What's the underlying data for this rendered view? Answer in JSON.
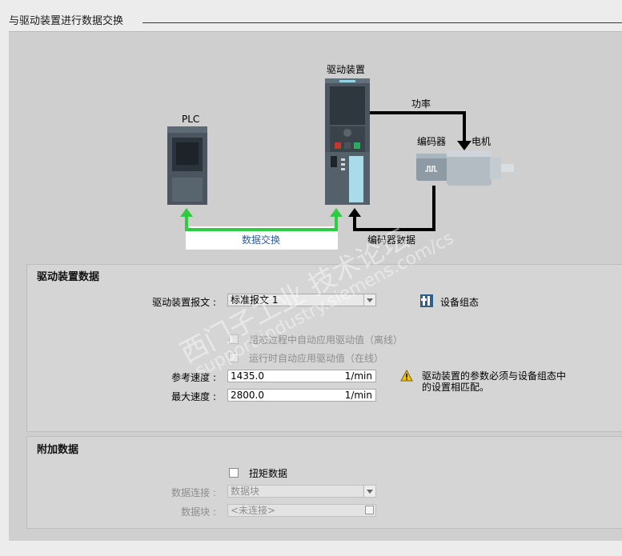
{
  "page": {
    "title": "与驱动装置进行数据交换"
  },
  "diagram": {
    "drive_label": "驱动装置",
    "plc_label": "PLC",
    "power_label": "功率",
    "encoder_label": "编码器",
    "motor_label": "电机",
    "data_exchange_label": "数据交换",
    "encoder_data_label": "编码器数据",
    "colors": {
      "data_line": "#2ecc40",
      "power_line": "#000000"
    }
  },
  "drive_data": {
    "title": "驱动装置数据",
    "telegram": {
      "label": "驱动装置报文 :",
      "value": "标准报文 1"
    },
    "config_button_label": "设备组态",
    "auto_apply_offline": "组态过程中自动应用驱动值（离线）",
    "auto_apply_online": "运行时自动应用驱动值（在线）",
    "ref_speed": {
      "label": "参考速度 :",
      "value": "1435.0",
      "unit": "1/min"
    },
    "max_speed": {
      "label": "最大速度 :",
      "value": "2800.0",
      "unit": "1/min"
    },
    "warning_line1": "驱动装置的参数必须与设备组态中",
    "warning_line2": "的设置相匹配。"
  },
  "additional_data": {
    "title": "附加数据",
    "torque_label": "扭矩数据",
    "data_connection": {
      "label": "数据连接 :",
      "value": "数据块"
    },
    "data_block": {
      "label": "数据块 :",
      "value": "<未连接>"
    }
  },
  "watermark": {
    "line1": "西门子工业  技术论坛",
    "line2": "support.industry.siemens.com/cs"
  }
}
